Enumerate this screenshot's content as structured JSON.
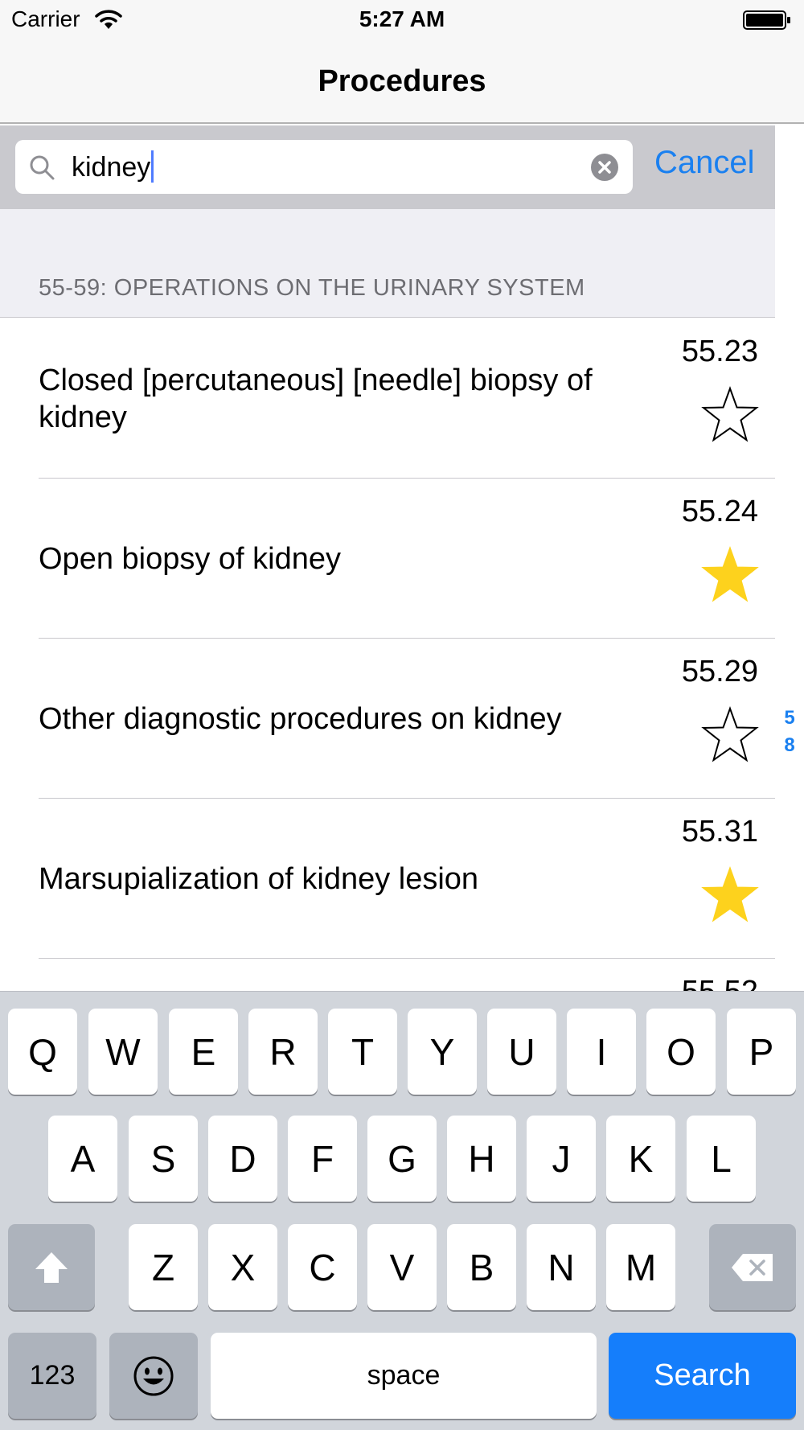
{
  "status_bar": {
    "carrier": "Carrier",
    "time": "5:27 AM"
  },
  "nav": {
    "title": "Procedures"
  },
  "search": {
    "query": "kidney",
    "cancel_label": "Cancel"
  },
  "section": {
    "title": "55-59: OPERATIONS ON THE URINARY SYSTEM"
  },
  "rows": [
    {
      "title": "Closed [percutaneous] [needle] biopsy of kidney",
      "code": "55.23",
      "favorite": false
    },
    {
      "title": "Open biopsy of kidney",
      "code": "55.24",
      "favorite": true
    },
    {
      "title": "Other diagnostic procedures on kidney",
      "code": "55.29",
      "favorite": false
    },
    {
      "title": "Marsupialization of kidney lesion",
      "code": "55.31",
      "favorite": true
    },
    {
      "title": "",
      "code": "55.52",
      "favorite": false
    }
  ],
  "section_index": [
    "5",
    "8"
  ],
  "keyboard": {
    "row1": [
      "Q",
      "W",
      "E",
      "R",
      "T",
      "Y",
      "U",
      "I",
      "O",
      "P"
    ],
    "row2": [
      "A",
      "S",
      "D",
      "F",
      "G",
      "H",
      "J",
      "K",
      "L"
    ],
    "row3": [
      "Z",
      "X",
      "C",
      "V",
      "B",
      "N",
      "M"
    ],
    "numbers_label": "123",
    "space_label": "space",
    "search_label": "Search"
  },
  "colors": {
    "accent": "#1a80f0",
    "star_fill": "#fdd21d",
    "keyboard_bg": "#d1d5db",
    "search_key": "#157efb"
  },
  "icons": {
    "search": "magnifier-icon",
    "clear": "clear-circle-icon",
    "favorite": "star-icon",
    "shift": "shift-arrow-icon",
    "delete": "backspace-icon",
    "emoji": "smiley-icon"
  }
}
